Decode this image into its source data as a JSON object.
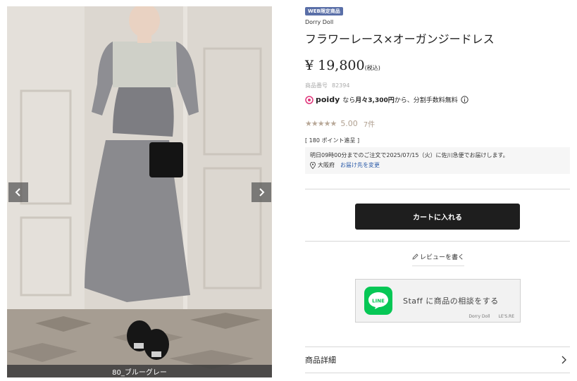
{
  "gallery": {
    "caption": "80_ブルーグレー",
    "prev_icon": "chevron-left-icon",
    "next_icon": "chevron-right-icon"
  },
  "product": {
    "badge": "WEB限定商品",
    "brand": "Dorry Doll",
    "title": "フラワーレース×オーガンジードレス",
    "price": "¥ 19,800",
    "price_tax": "(税込)",
    "sku_label": "商品番号",
    "sku_value": "82394"
  },
  "poidy": {
    "logo": "poidy",
    "text_prefix": "なら",
    "text_bold": "月々3,300円",
    "text_suffix": "から、分割手数料無料",
    "info_icon": "info-icon"
  },
  "rating": {
    "stars": "★★★★★",
    "score": "5.00",
    "count": "7件"
  },
  "points": "[ 180 ポイント進呈 ]",
  "delivery": {
    "message": "明日09時00分までのご注文で2025/07/15（火）に佐川急便でお届けします。",
    "location": "大阪府",
    "change_link": "お届け先を変更",
    "location_icon": "location-pin-icon"
  },
  "cart_button": "カートに入れる",
  "review_link": "レビューを書く",
  "line_banner": {
    "logo_text": "LINE",
    "text": "Staff に商品の相談をする",
    "brand1": "Dorry Doll",
    "brand2": "LE'S.RE"
  },
  "details": {
    "label": "商品詳細"
  },
  "colors": {
    "badge": "#5a6fa8",
    "cart_bg": "#1e1e1e",
    "line_green": "#06c755",
    "link": "#2a5aa8"
  }
}
